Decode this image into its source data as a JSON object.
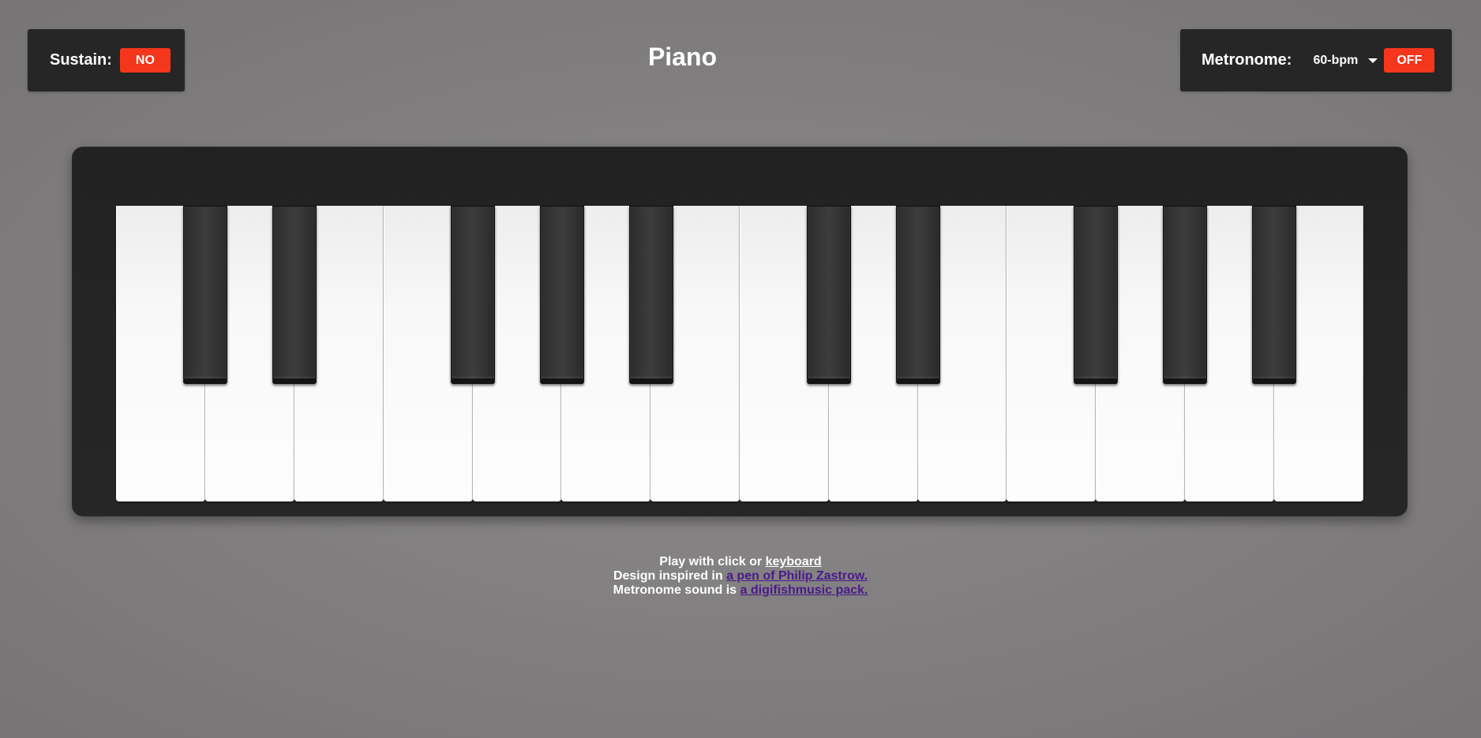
{
  "sustain": {
    "label": "Sustain:",
    "button": "NO",
    "button_color": "#f4361d"
  },
  "title": "Piano",
  "metronome": {
    "label": "Metronome:",
    "bpm_selected": "60-bpm",
    "button": "OFF",
    "button_color": "#f4361d"
  },
  "piano": {
    "white_key_count": 14,
    "black_key_count": 10,
    "white_keys": [
      "C",
      "D",
      "E",
      "F",
      "G",
      "A",
      "B",
      "C",
      "D",
      "E",
      "F",
      "G",
      "A",
      "B"
    ],
    "black_keys": [
      "C#",
      "D#",
      "F#",
      "G#",
      "A#",
      "C#",
      "D#",
      "F#",
      "G#",
      "A#"
    ]
  },
  "footer": {
    "line1_text": "Play with click or ",
    "line1_link": "keyboard",
    "line2_text": "Design inspired in ",
    "line2_link": "a pen of Philip Zastrow.",
    "line3_text": "Metronome sound is ",
    "line3_link": "a digifishmusic pack."
  }
}
